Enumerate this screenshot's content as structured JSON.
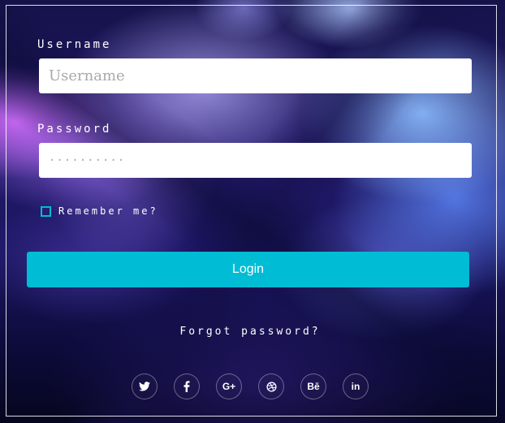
{
  "form": {
    "username_label": "Username",
    "username_placeholder": "Username",
    "username_value": "",
    "password_label": "Password",
    "password_placeholder": "··········",
    "password_value": "",
    "remember_label": "Remember me?",
    "remember_checked": false,
    "login_label": "Login",
    "forgot_label": "Forgot password?"
  },
  "social": [
    {
      "name": "twitter",
      "icon": "twitter-icon"
    },
    {
      "name": "facebook",
      "icon": "facebook-icon"
    },
    {
      "name": "google-plus",
      "icon": "google-plus-icon",
      "glyph": "G+"
    },
    {
      "name": "dribbble",
      "icon": "dribbble-icon"
    },
    {
      "name": "behance",
      "icon": "behance-icon",
      "glyph": "Bē"
    },
    {
      "name": "linkedin",
      "icon": "linkedin-icon",
      "glyph": "in"
    }
  ],
  "colors": {
    "accent": "#00bcd4",
    "input_background": "#ffffff",
    "text": "#ffffff"
  }
}
